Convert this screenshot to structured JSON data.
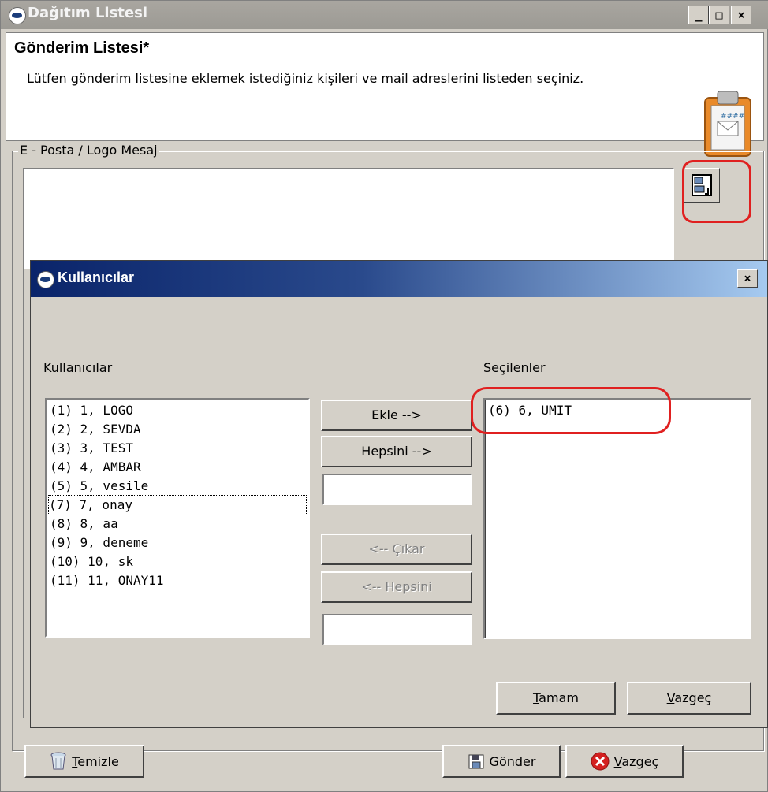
{
  "window": {
    "title": "Dağıtım Listesi",
    "min_label": "_",
    "max_label": "□",
    "close_label": "×"
  },
  "header": {
    "title": "Gönderim Listesi*",
    "description": "Lütfen gönderim listesine eklemek istediğiniz kişileri ve mail adreslerini  listeden seçiniz."
  },
  "group": {
    "label": "E - Posta / Logo Mesaj"
  },
  "dialog": {
    "title": "Kullanıcılar",
    "close_label": "×",
    "left_label": "Kullanıcılar",
    "right_label": "Seçilenler",
    "users": [
      "(1) 1, LOGO",
      "(2) 2, SEVDA",
      "(3) 3, TEST",
      "(4) 4, AMBAR",
      "(5) 5, vesile",
      "(7) 7, onay",
      "(8) 8, aa",
      "(9) 9, deneme",
      "(10) 10, sk",
      "(11) 11, ONAY11"
    ],
    "selected": [
      "(6) 6, UMIT"
    ],
    "buttons": {
      "add": "Ekle -->",
      "add_all": "Hepsini -->",
      "remove": "<-- Çıkar",
      "remove_all": "<-- Hepsini",
      "ok_u": "T",
      "ok_rest": "amam",
      "cancel_u": "V",
      "cancel_rest": "azgeç"
    }
  },
  "footer": {
    "clear_u": "T",
    "clear_rest": "emizle",
    "send": "Gönder",
    "cancel_u": "V",
    "cancel_rest": "azgeç"
  },
  "colors": {
    "highlight": "#e02020",
    "titlebar": "#0a246a"
  }
}
